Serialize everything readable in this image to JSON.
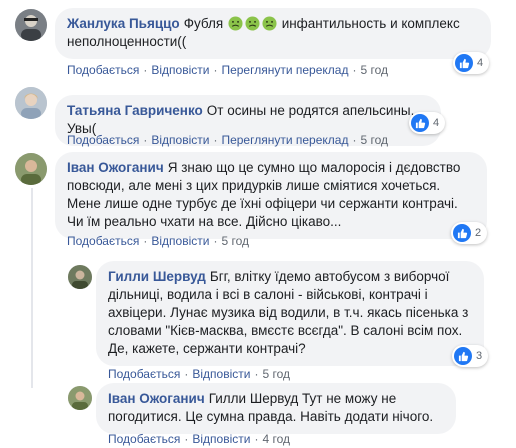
{
  "comments": [
    {
      "author": "Жанлука Пьяццо",
      "text_before": "Фубля",
      "emoji_icons": [
        "nauseated-face-icon",
        "nauseated-face-icon",
        "nauseated-face-icon"
      ],
      "text_after": " инфантильность и комплекс неполноценности((",
      "actions": {
        "like": "Подобається",
        "reply": "Відповісти",
        "translate": "Переглянути переклад",
        "time": "5 год"
      },
      "reaction_count": "4"
    },
    {
      "author": "Татьяна Гавриченко",
      "text": "От осины не родятся апельсины. Увы(",
      "actions": {
        "like": "Подобається",
        "reply": "Відповісти",
        "translate": "Переглянути переклад",
        "time": "5 год"
      },
      "reaction_count": "4"
    },
    {
      "author": "Іван Ожоганич",
      "text": "Я знаю що це сумно що малоросія і дєдовство повсюди, але мені з цих придурків лише сміятися хочеться. Мене лише одне турбує де їхні офіцери чи сержанти контрачі. Чи їм реально чхати на все. Дійсно цікаво...",
      "actions": {
        "like": "Подобається",
        "reply": "Відповісти",
        "time": "5 год"
      },
      "reaction_count": "2"
    },
    {
      "author": "Гилли Шервуд",
      "text": "Бгг, влітку їдемо автобусом з виборчої дільниці, водила і всі в салоні - військові, контрачі і ахвіцери. Лунає музика від водили, в т.ч. якась пісенька з словами \"Кієв-масква, вмєстє всєгда\". В салоні всім пох. Де, кажете, сержанти контрачі?",
      "actions": {
        "like": "Подобається",
        "reply": "Відповісти",
        "time": "5 год"
      },
      "reaction_count": "3"
    },
    {
      "author": "Іван Ожоганич",
      "text": "Гилли Шервуд Тут не можу не погодитися. Це сумна правда. Навіть додати нічого.",
      "actions": {
        "like": "Подобається",
        "reply": "Відповісти",
        "time": "4 год"
      }
    }
  ],
  "colors": {
    "link": "#385898",
    "bubble": "#f2f3f5",
    "like_blue": "#2078f4",
    "meta": "#606770"
  },
  "icons": {
    "like": "thumbs-up-icon",
    "avatar": "user-avatar"
  }
}
